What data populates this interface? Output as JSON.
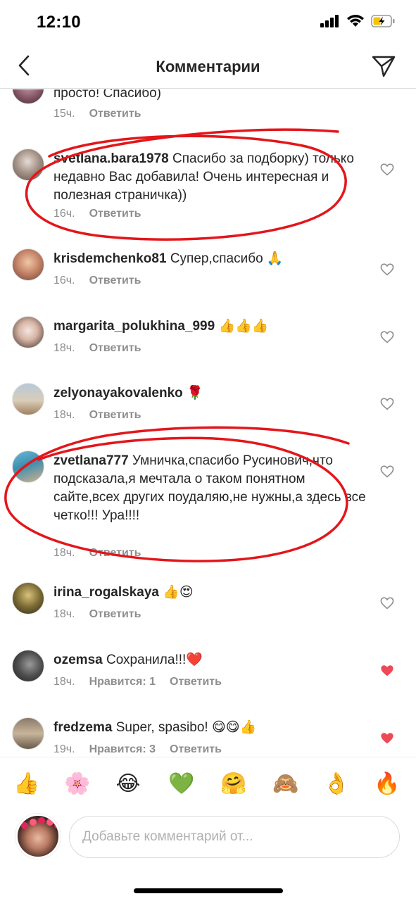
{
  "status_bar": {
    "time": "12:10"
  },
  "header": {
    "title": "Комментарии"
  },
  "comments": [
    {
      "username": "",
      "text": "просто! Спасибо)",
      "time": "15ч.",
      "likes": "",
      "reply": "Ответить",
      "liked": false
    },
    {
      "username": "svetlana.bara1978",
      "text": "Спасибо за подборку) только недавно Вас добавила! Очень интересная и полезная страничка))",
      "time": "16ч.",
      "likes": "",
      "reply": "Ответить",
      "liked": false
    },
    {
      "username": "krisdemchenko81",
      "text": "Супер,спасибо 🙏",
      "time": "16ч.",
      "likes": "",
      "reply": "Ответить",
      "liked": false
    },
    {
      "username": "margarita_polukhina_999",
      "text": "👍👍👍",
      "time": "18ч.",
      "likes": "",
      "reply": "Ответить",
      "liked": false
    },
    {
      "username": "zelyonayakovalenko",
      "text": "🌹",
      "time": "18ч.",
      "likes": "",
      "reply": "Ответить",
      "liked": false
    },
    {
      "username": "zvetlana777",
      "text": "Умничка,спасибо Русинович,что подсказала,я мечтала о таком понятном сайте,всех других поудаляю,не нужны,а здесь все четко!!! Ура!!!!",
      "time": "18ч.",
      "likes": "",
      "reply": "Ответить",
      "liked": false
    },
    {
      "username": "irina_rogalskaya",
      "text": "👍😍",
      "time": "18ч.",
      "likes": "",
      "reply": "Ответить",
      "liked": false
    },
    {
      "username": "ozemsa",
      "text": "Сохранила!!!❤️",
      "time": "18ч.",
      "likes": "Нравится: 1",
      "reply": "Ответить",
      "liked": true
    },
    {
      "username": "fredzema",
      "text": "Super, spasibo! 😋😋👍",
      "time": "19ч.",
      "likes": "Нравится: 3",
      "reply": "Ответить",
      "liked": true
    }
  ],
  "emoji_bar": [
    "👍",
    "🌸",
    "😂",
    "💚",
    "🤗",
    "🙈",
    "👌",
    "🔥"
  ],
  "composer": {
    "placeholder": "Добавьте комментарий от..."
  },
  "colors": {
    "annotation": "#e3161b",
    "liked_heart": "#ed4956",
    "muted": "#8e8e8e"
  },
  "icons": [
    "cellular-signal-icon",
    "wifi-icon",
    "battery-charging-icon",
    "back-chevron-icon",
    "send-direct-icon",
    "heart-outline-icon",
    "heart-filled-icon"
  ]
}
